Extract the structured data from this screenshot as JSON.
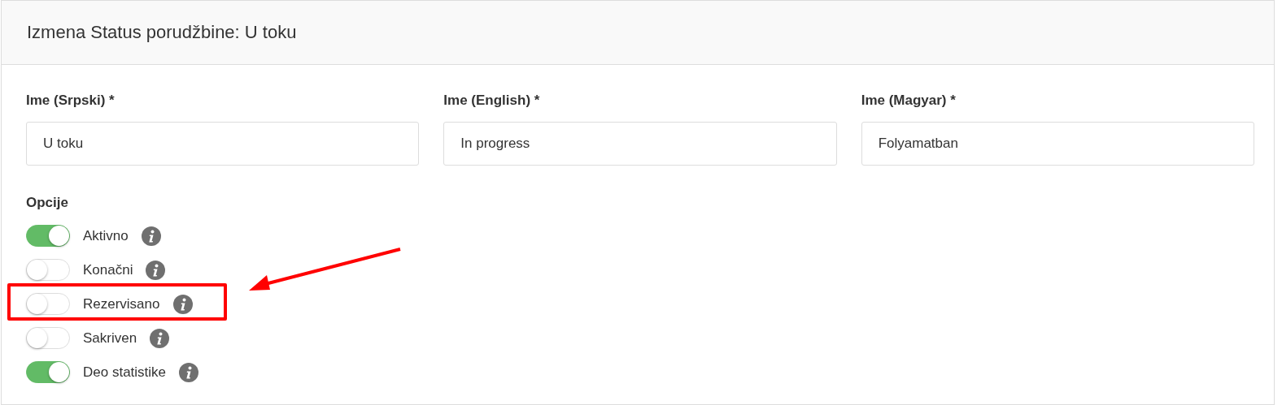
{
  "title": "Izmena Status porudžbine: U toku",
  "fields": [
    {
      "label": "Ime (Srpski) *",
      "value": "U toku"
    },
    {
      "label": "Ime (English) *",
      "value": "In progress"
    },
    {
      "label": "Ime (Magyar) *",
      "value": "Folyamatban"
    }
  ],
  "options_heading": "Opcije",
  "options": [
    {
      "label": "Aktivno",
      "on": true,
      "highlighted": false
    },
    {
      "label": "Konačni",
      "on": false,
      "highlighted": false
    },
    {
      "label": "Rezervisano",
      "on": false,
      "highlighted": true
    },
    {
      "label": "Sakriven",
      "on": false,
      "highlighted": false
    },
    {
      "label": "Deo statistike",
      "on": true,
      "highlighted": false
    }
  ]
}
